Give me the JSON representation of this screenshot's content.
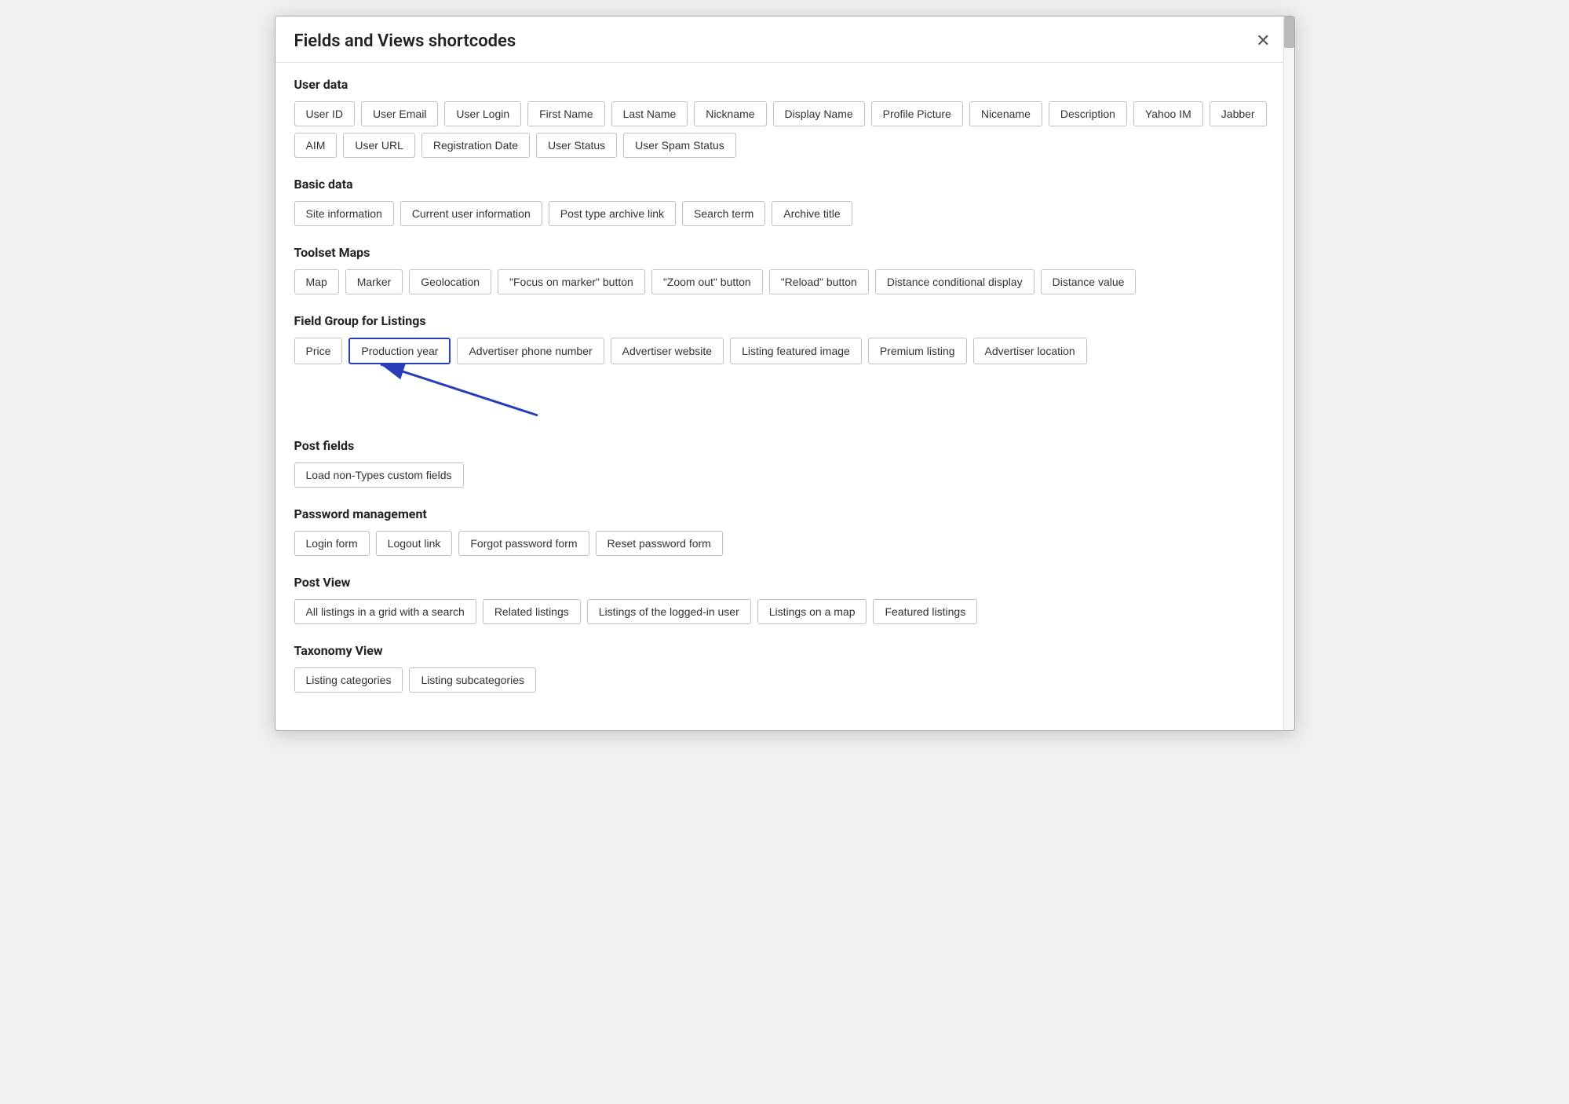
{
  "modal": {
    "title": "Fields and Views shortcodes",
    "close_label": "✕"
  },
  "sections": [
    {
      "id": "user-data",
      "title": "User data",
      "tags": [
        "User ID",
        "User Email",
        "User Login",
        "First Name",
        "Last Name",
        "Nickname",
        "Display Name",
        "Profile Picture",
        "Nicename",
        "Description",
        "Yahoo IM",
        "Jabber",
        "AIM",
        "User URL",
        "Registration Date",
        "User Status",
        "User Spam Status"
      ],
      "highlighted": []
    },
    {
      "id": "basic-data",
      "title": "Basic data",
      "tags": [
        "Site information",
        "Current user information",
        "Post type archive link",
        "Search term",
        "Archive title"
      ],
      "highlighted": []
    },
    {
      "id": "toolset-maps",
      "title": "Toolset Maps",
      "tags": [
        "Map",
        "Marker",
        "Geolocation",
        "\"Focus on marker\" button",
        "\"Zoom out\" button",
        "\"Reload\" button",
        "Distance conditional display",
        "Distance value"
      ],
      "highlighted": []
    },
    {
      "id": "field-group-listings",
      "title": "Field Group for Listings",
      "tags": [
        "Price",
        "Production year",
        "Advertiser phone number",
        "Advertiser website",
        "Listing featured image",
        "Premium listing",
        "Advertiser location"
      ],
      "highlighted": [
        "Production year"
      ],
      "has_arrow": true,
      "arrow_tag": "Production year"
    },
    {
      "id": "post-fields",
      "title": "Post fields",
      "tags": [
        "Load non-Types custom fields"
      ],
      "highlighted": []
    },
    {
      "id": "password-management",
      "title": "Password management",
      "tags": [
        "Login form",
        "Logout link",
        "Forgot password form",
        "Reset password form"
      ],
      "highlighted": []
    },
    {
      "id": "post-view",
      "title": "Post View",
      "tags": [
        "All listings in a grid with a search",
        "Related listings",
        "Listings of the logged-in user",
        "Listings on a map",
        "Featured listings"
      ],
      "highlighted": []
    },
    {
      "id": "taxonomy-view",
      "title": "Taxonomy View",
      "tags": [
        "Listing categories",
        "Listing subcategories"
      ],
      "highlighted": []
    }
  ]
}
